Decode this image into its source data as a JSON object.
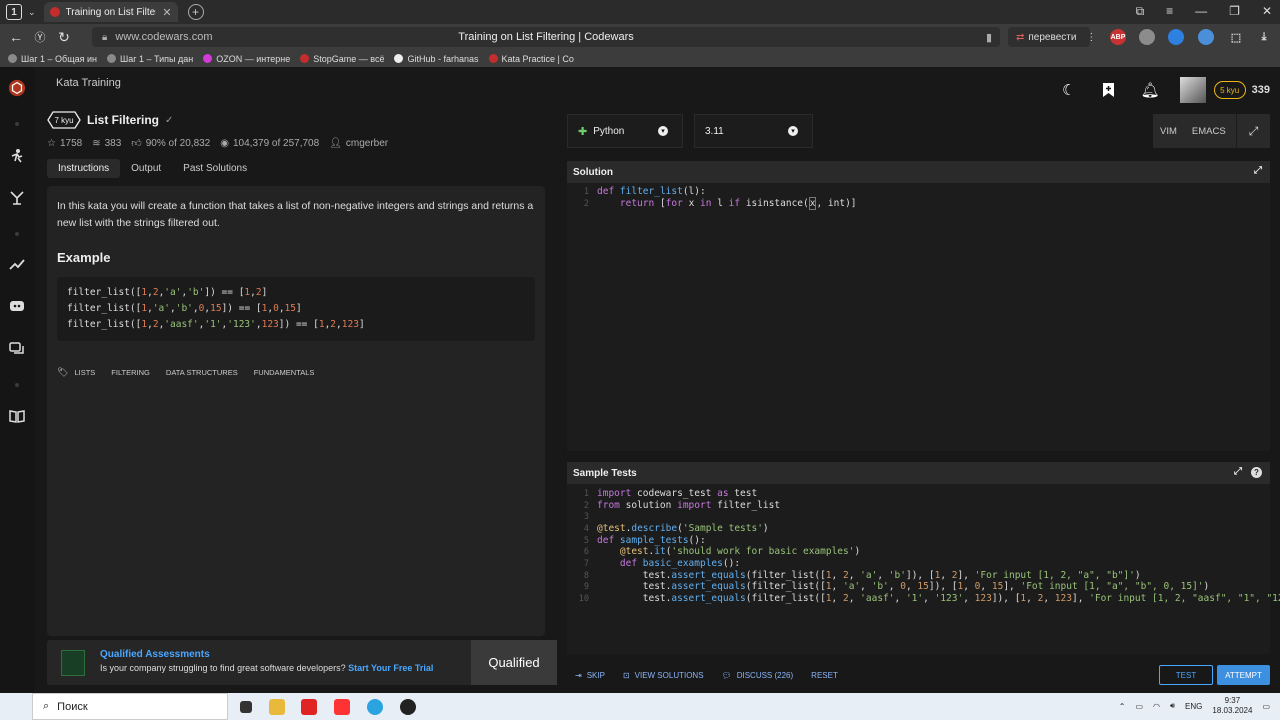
{
  "browser": {
    "tab_count": "1",
    "tab_title": "Training on List Filtering",
    "url": "www.codewars.com",
    "page_title": "Training on List Filtering | Codewars",
    "translate_label": "перевести",
    "bookmarks": [
      {
        "label": "Шаг 1 – Общая ин",
        "color": "#8a8a8a"
      },
      {
        "label": "Шаг 1 – Типы дан",
        "color": "#8a8a8a"
      },
      {
        "label": "OZON — интерне",
        "color": "#d23bd8"
      },
      {
        "label": "StopGame — всё",
        "color": "#c52d2d"
      },
      {
        "label": "GitHub - farhanas",
        "color": "#eeeeee"
      },
      {
        "label": "Kata Practice | Co",
        "color": "#c52d2d"
      }
    ]
  },
  "topbar": {
    "breadcrumb": "Kata Training",
    "rank": "5 kyu",
    "honor": "339"
  },
  "kata": {
    "kyu": "7 kyu",
    "title": "List Filtering",
    "stars": "1758",
    "collections": "383",
    "satisfaction": "90% of 20,832",
    "completed": "104,379 of 257,708",
    "author": "cmgerber",
    "tabs": [
      "Instructions",
      "Output",
      "Past Solutions"
    ],
    "description": "In this kata you will create a function that takes a list of non-negative integers and strings and returns a new list with the strings filtered out.",
    "example_heading": "Example",
    "tags": [
      "LISTS",
      "FILTERING",
      "DATA STRUCTURES",
      "FUNDAMENTALS"
    ]
  },
  "promo": {
    "heading": "Qualified Assessments",
    "body": "Is your company struggling to find great software developers?",
    "cta": "Start Your Free Trial",
    "brand": "Qualified"
  },
  "editor": {
    "language": "Python",
    "version": "3.11",
    "vim_label": "VIM",
    "emacs_label": "EMACS",
    "solution_label": "Solution",
    "sample_tests_label": "Sample Tests"
  },
  "actions": {
    "skip": "SKIP",
    "view_solutions": "VIEW SOLUTIONS",
    "discuss": "DISCUSS (226)",
    "reset": "RESET",
    "test": "TEST",
    "attempt": "ATTEMPT"
  },
  "taskbar": {
    "search_placeholder": "Поиск",
    "lang": "ENG",
    "time": "9:37",
    "date": "18.03.2024"
  }
}
